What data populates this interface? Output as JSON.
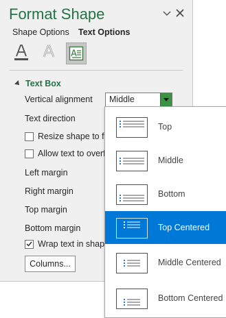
{
  "pane": {
    "title": "Format Shape",
    "tabs": [
      "Shape Options",
      "Text Options"
    ],
    "icon_tabs": [
      "text-fill-outline-icon",
      "text-effects-icon",
      "textbox-icon"
    ],
    "section": "Text Box",
    "vertical_alignment": {
      "label": "Vertical alignment",
      "value": "Middle"
    },
    "labels": {
      "text_direction": "Text direction",
      "resize": "Resize shape to fit t",
      "overflow": "Allow text to overfl",
      "left_margin": "Left margin",
      "right_margin": "Right margin",
      "top_margin": "Top margin",
      "bottom_margin": "Bottom margin",
      "wrap": "Wrap text in shape",
      "columns": "Columns..."
    },
    "checkboxes": {
      "resize": false,
      "overflow": false,
      "wrap": true
    }
  },
  "dropdown": {
    "options": [
      "Top",
      "Middle",
      "Bottom",
      "Top Centered",
      "Middle Centered",
      "Bottom Centered"
    ],
    "selected": "Top Centered"
  },
  "colors": {
    "accent": "#217346",
    "selection": "#0078d7",
    "arrow": "#3c9146"
  }
}
